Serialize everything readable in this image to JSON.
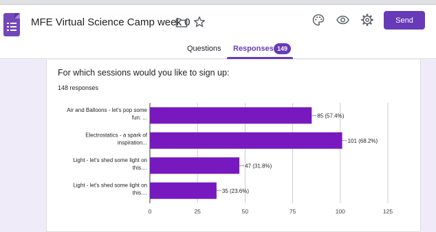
{
  "header": {
    "doc_title": "MFE Virtual Science Camp week 0",
    "send_label": "Send",
    "icons": [
      "forms-logo-icon",
      "folder-icon",
      "star-icon",
      "palette-icon",
      "eye-icon",
      "gear-icon"
    ]
  },
  "tabs": {
    "questions_label": "Questions",
    "responses_label": "Responses",
    "responses_count": "149"
  },
  "question": {
    "title": "For which sessions would you like to sign up:",
    "responses_text": "148 responses"
  },
  "colors": {
    "accent": "#673ab7",
    "bar": "#7719bf",
    "page_bg": "#f0ebf8"
  },
  "chart_data": {
    "type": "bar",
    "orientation": "horizontal",
    "categories": [
      [
        "Air and Balloons - let's pop some",
        "fun: ..."
      ],
      [
        "Electrostatics - a spark of",
        "inspiration..."
      ],
      [
        "Light - let's shed some light on",
        "this...."
      ],
      [
        "Light - let's shed some light on",
        "this...."
      ]
    ],
    "values": [
      85,
      101,
      47,
      35
    ],
    "data_labels": [
      "85 (57.4%)",
      "101 (68.2%)",
      "47 (31.8%)",
      "35 (23.6%)"
    ],
    "xlim": [
      0,
      125
    ],
    "xticks": [
      0,
      25,
      50,
      75,
      100,
      125
    ],
    "grid": true
  }
}
